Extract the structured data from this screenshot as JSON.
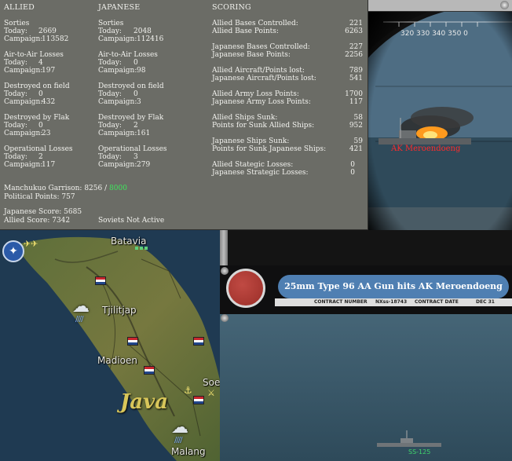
{
  "stats": {
    "headers": {
      "allied": "ALLIED",
      "japanese": "JAPANESE",
      "scoring": "SCORING"
    },
    "allied": [
      {
        "title": "Sorties",
        "today_label": "Today:",
        "today": "2669",
        "campaign_label": "Campaign:",
        "campaign": "113582"
      },
      {
        "title": "Air-to-Air Losses",
        "today_label": "Today:",
        "today": "4",
        "campaign_label": "Campaign:",
        "campaign": "197"
      },
      {
        "title": "Destroyed on field",
        "today_label": "Today:",
        "today": "0",
        "campaign_label": "Campaign:",
        "campaign": "432"
      },
      {
        "title": "Destroyed by Flak",
        "today_label": "Today:",
        "today": "0",
        "campaign_label": "Campaign:",
        "campaign": "23"
      },
      {
        "title": "Operational Losses",
        "today_label": "Today:",
        "today": "2",
        "campaign_label": "Campaign:",
        "campaign": "117"
      }
    ],
    "japanese": [
      {
        "title": "Sorties",
        "today_label": "Today:",
        "today": "2048",
        "campaign_label": "Campaign:",
        "campaign": "112416"
      },
      {
        "title": "Air-to-Air Losses",
        "today_label": "Today:",
        "today": "0",
        "campaign_label": "Campaign:",
        "campaign": "98"
      },
      {
        "title": "Destroyed on field",
        "today_label": "Today:",
        "today": "0",
        "campaign_label": "Campaign:",
        "campaign": "3"
      },
      {
        "title": "Destroyed by Flak",
        "today_label": "Today:",
        "today": "2",
        "campaign_label": "Campaign:",
        "campaign": "161"
      },
      {
        "title": "Operational Losses",
        "today_label": "Today:",
        "today": "3",
        "campaign_label": "Campaign:",
        "campaign": "279"
      }
    ],
    "scoring": [
      {
        "label": "Allied Bases Controlled:",
        "value": "221"
      },
      {
        "label": "Allied Base Points:",
        "value": "6263"
      },
      {
        "label": "Japanese Bases Controlled:",
        "value": "227"
      },
      {
        "label": "Japanese Base Points:",
        "value": "2256"
      },
      {
        "label": "Allied Aircraft/Points lost:",
        "value": "789"
      },
      {
        "label": "Japanese Aircraft/Points lost:",
        "value": "541"
      },
      {
        "label": "Allied Army Loss Points:",
        "value": "1700"
      },
      {
        "label": "Japanese Army Loss Points:",
        "value": "117"
      },
      {
        "label": "Allied Ships Sunk:",
        "value": "58"
      },
      {
        "label": "Points for Sunk Allied Ships:",
        "value": "952"
      },
      {
        "label": "Japanese Ships Sunk:",
        "value": "59"
      },
      {
        "label": "Points for Sunk Japanese Ships:",
        "value": "421"
      },
      {
        "label": "Allied Stategic Losses:",
        "value": "0"
      },
      {
        "label": "Japanese Strategic Losses:",
        "value": "0"
      }
    ],
    "garrison_label": "Manchukuo Garrison:",
    "garrison_value": "8256",
    "garrison_sep": "/",
    "garrison_required": "8000",
    "political_points": "Political Points:  757",
    "japanese_score": "Japanese Score:  5685",
    "allied_score": "Allied Score:  7342",
    "soviets": "Soviets Not Active"
  },
  "map": {
    "labels": {
      "batavia": "Batavia",
      "tjilitjap": "Tjilitjap",
      "madioen": "Madioen",
      "soe": "Soe",
      "malang": "Malang",
      "java": "Java"
    }
  },
  "combat": {
    "range_text": "320  330  340  350  0",
    "target_label_top": "AK Meroendoeng",
    "message": "25mm Type 96 AA Gun hits AK Meroendoeng",
    "contract_number_label": "CONTRACT NUMBER",
    "contract_number": "NXss-18743",
    "contract_date_label": "CONTRACT DATE",
    "contract_date": "DEC 31",
    "bottom_ship_label": "SS-125"
  }
}
